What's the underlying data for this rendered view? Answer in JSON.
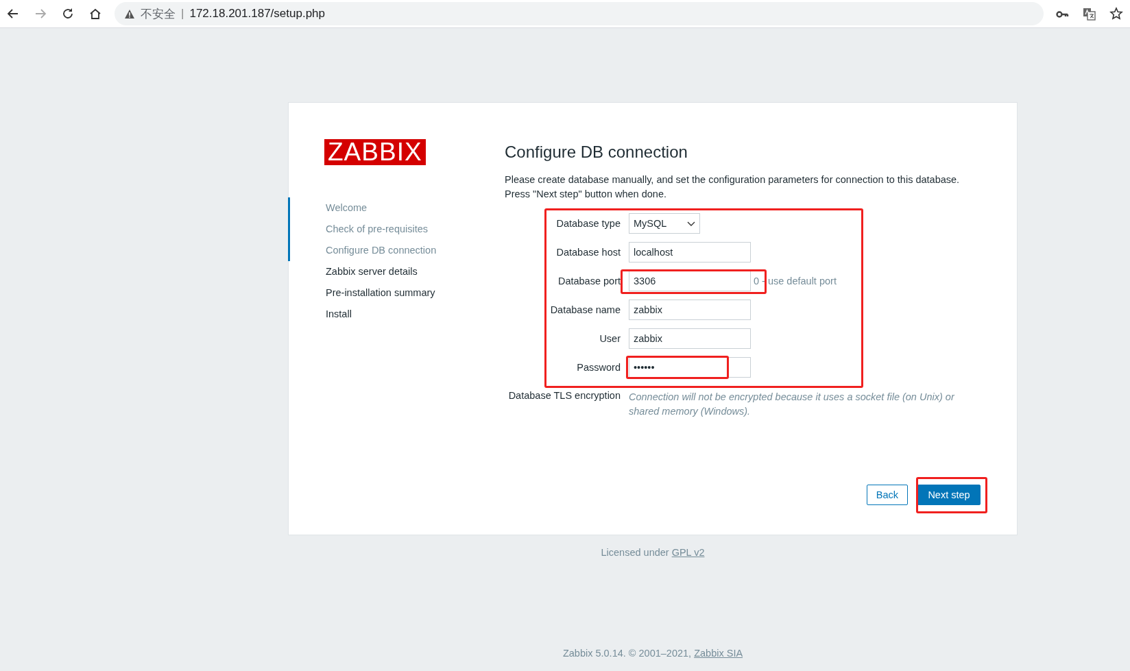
{
  "browser": {
    "security_label": "不安全",
    "separator": "|",
    "url": "172.18.201.187/setup.php",
    "forward_disabled": true
  },
  "logo": "ZABBIX",
  "steps": [
    {
      "label": "Welcome",
      "completed": true
    },
    {
      "label": "Check of pre-requisites",
      "completed": true
    },
    {
      "label": "Configure DB connection",
      "completed": true
    },
    {
      "label": "Zabbix server details",
      "completed": false
    },
    {
      "label": "Pre-installation summary",
      "completed": false
    },
    {
      "label": "Install",
      "completed": false
    }
  ],
  "heading": "Configure DB connection",
  "description": [
    "Please create database manually, and set the configuration parameters for connection to this database.",
    "Press \"Next step\" button when done."
  ],
  "form": {
    "highlighted": true,
    "rows": [
      {
        "kind": "select",
        "label": "Database type",
        "value": "MySQL",
        "highlighted": false
      },
      {
        "kind": "text",
        "label": "Database host",
        "value": "localhost",
        "highlighted": false
      },
      {
        "kind": "text",
        "label": "Database port",
        "value": "3306",
        "hint": "0 - use default port",
        "highlighted": true
      },
      {
        "kind": "text",
        "label": "Database name",
        "value": "zabbix",
        "highlighted": false
      },
      {
        "kind": "text",
        "label": "User",
        "value": "zabbix",
        "highlighted": false
      },
      {
        "kind": "text",
        "label": "Password",
        "value": "••••••",
        "highlighted": true
      }
    ]
  },
  "tls": {
    "label": "Database TLS encryption",
    "note": "Connection will not be encrypted because it uses a socket file (on Unix) or shared memory (Windows)."
  },
  "buttons": [
    {
      "label": "Back",
      "kind": "secondary",
      "highlighted": false
    },
    {
      "label": "Next step",
      "kind": "primary",
      "highlighted": true
    }
  ],
  "license": {
    "text": "Licensed under",
    "link": "GPL v2"
  },
  "footer": {
    "text": "Zabbix 5.0.14. © 2001–2021,",
    "link": "Zabbix SIA"
  }
}
